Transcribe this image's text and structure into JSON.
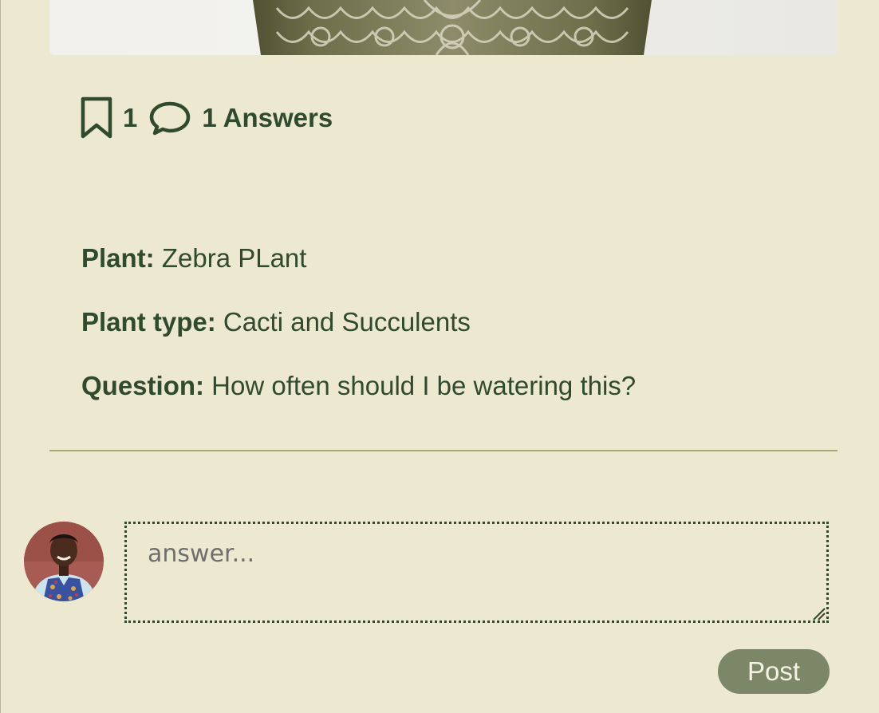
{
  "post": {
    "image": {
      "description_icon": "ceramic-planter-image"
    },
    "stats": {
      "bookmark_icon": "bookmark-icon",
      "bookmark_count": "1",
      "comment_icon": "comment-icon",
      "answers_text": "1 Answers"
    },
    "details": {
      "plant_label": "Plant:",
      "plant_value": "Zebra PLant",
      "type_label": "Plant type:",
      "type_value": "Cacti and Succulents",
      "question_label": "Question:",
      "question_value": "How often should I be watering this?"
    }
  },
  "answer_form": {
    "avatar_icon": "user-avatar",
    "placeholder": "answer...",
    "value": "",
    "post_label": "Post"
  },
  "colors": {
    "background": "#ede8d0",
    "text": "#2f4a2c",
    "divider": "#a8a77a",
    "button": "#7b8766",
    "button_text": "#f5f3e6"
  }
}
